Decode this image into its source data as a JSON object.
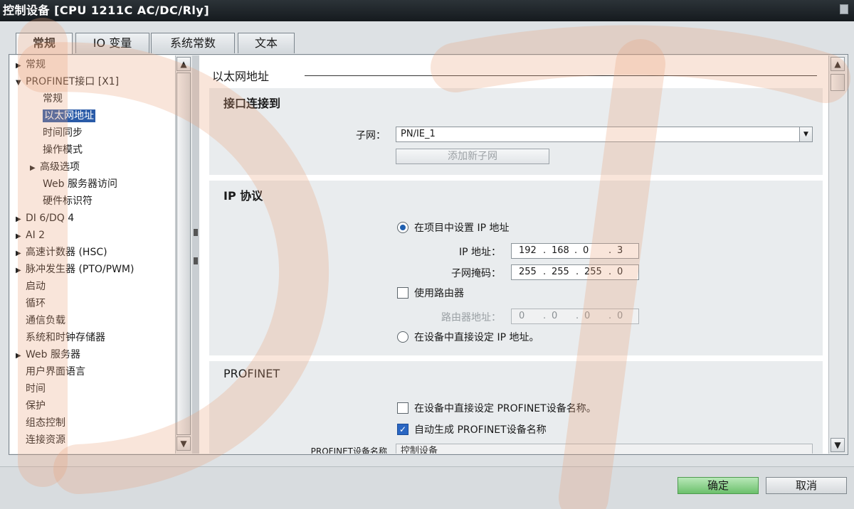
{
  "window": {
    "title": "控制设备 [CPU 1211C AC/DC/Rly]"
  },
  "tabs": [
    {
      "label": "常规",
      "active": true
    },
    {
      "label": "IO 变量",
      "active": false
    },
    {
      "label": "系统常数",
      "active": false
    },
    {
      "label": "文本",
      "active": false
    }
  ],
  "tree": {
    "items": [
      {
        "label": "常规",
        "arrow": "▶"
      },
      {
        "label": "PROFINET接口 [X1]",
        "arrow": "▼"
      },
      {
        "label": "常规",
        "arrow": ""
      },
      {
        "label": "以太网地址",
        "arrow": "",
        "selected": true
      },
      {
        "label": "时间同步",
        "arrow": ""
      },
      {
        "label": "操作模式",
        "arrow": ""
      },
      {
        "label": "高级选项",
        "arrow": "▶"
      },
      {
        "label": "Web 服务器访问",
        "arrow": ""
      },
      {
        "label": "硬件标识符",
        "arrow": ""
      },
      {
        "label": "DI 6/DQ 4",
        "arrow": "▶"
      },
      {
        "label": "AI 2",
        "arrow": "▶"
      },
      {
        "label": "高速计数器 (HSC)",
        "arrow": "▶"
      },
      {
        "label": "脉冲发生器 (PTO/PWM)",
        "arrow": "▶"
      },
      {
        "label": "启动",
        "arrow": ""
      },
      {
        "label": "循环",
        "arrow": ""
      },
      {
        "label": "通信负载",
        "arrow": ""
      },
      {
        "label": "系统和时钟存储器",
        "arrow": ""
      },
      {
        "label": "Web 服务器",
        "arrow": "▶"
      },
      {
        "label": "用户界面语言",
        "arrow": ""
      },
      {
        "label": "时间",
        "arrow": ""
      },
      {
        "label": "保护",
        "arrow": ""
      },
      {
        "label": "组态控制",
        "arrow": ""
      },
      {
        "label": "连接资源",
        "arrow": ""
      }
    ]
  },
  "content": {
    "heading": "以太网地址",
    "interface_section": {
      "title": "接口连接到",
      "subnet_label": "子网：",
      "subnet_value": "PN/IE_1",
      "add_subnet_button": "添加新子网"
    },
    "ip_section": {
      "title": "IP 协议",
      "option_project": "在项目中设置 IP 地址",
      "ip_label": "IP 地址：",
      "ip_address": [
        "192",
        "168",
        "0",
        "3"
      ],
      "subnet_mask_label": "子网掩码：",
      "subnet_mask": [
        "255",
        "255",
        "255",
        "0"
      ],
      "use_router_label": "使用路由器",
      "router_label": "路由器地址：",
      "router_address": [
        "0",
        "0",
        "0",
        "0"
      ],
      "option_device": "在设备中直接设定 IP 地址。"
    },
    "profinet_section": {
      "title": "PROFINET",
      "option_direct_name": "在设备中直接设定 PROFINET设备名称。",
      "option_auto_name": "自动生成 PROFINET设备名称",
      "device_name_label": "PROFINET设备名称",
      "device_name_value": "控制设备"
    }
  },
  "footer": {
    "ok_label": "确定",
    "cancel_label": "取消"
  },
  "colors": {
    "selection": "#2a5ba8",
    "ok_button": "#6cc06c",
    "watermark": "#e8a07a"
  },
  "icons": {
    "tree_expand": "triangle-right-icon",
    "tree_collapse": "triangle-down-icon",
    "scroll_up": "chevron-up-icon",
    "scroll_down": "chevron-down-icon",
    "dropdown": "chevron-down-icon"
  }
}
